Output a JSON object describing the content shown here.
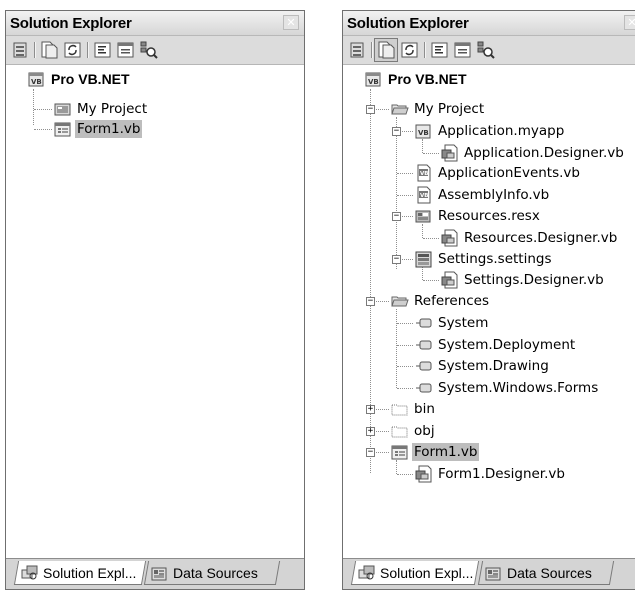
{
  "left": {
    "title": "Solution Explorer",
    "close_glyph": "✕",
    "project": "Pro VB.NET",
    "items": [
      "My Project",
      "Form1.vb"
    ],
    "tabs": [
      "Solution Expl...",
      "Data Sources"
    ]
  },
  "right": {
    "title": "Solution Explorer",
    "close_glyph": "✕",
    "project": "Pro VB.NET",
    "tree": [
      "My Project",
      "Application.myapp",
      "Application.Designer.vb",
      "ApplicationEvents.vb",
      "AssemblyInfo.vb",
      "Resources.resx",
      "Resources.Designer.vb",
      "Settings.settings",
      "Settings.Designer.vb",
      "References",
      "System",
      "System.Deployment",
      "System.Drawing",
      "System.Windows.Forms",
      "bin",
      "obj",
      "Form1.vb",
      "Form1.Designer.vb"
    ],
    "expander_glyphs": {
      "expanded": "−",
      "collapsed": "+"
    },
    "tabs": [
      "Solution Expl...",
      "Data Sources"
    ]
  },
  "icons": {
    "toolbar": [
      "properties-icon",
      "show-all-files-icon",
      "refresh-icon",
      "view-code-icon",
      "view-designer-icon",
      "class-view-icon"
    ],
    "selected_color": "#bdbdbd"
  }
}
